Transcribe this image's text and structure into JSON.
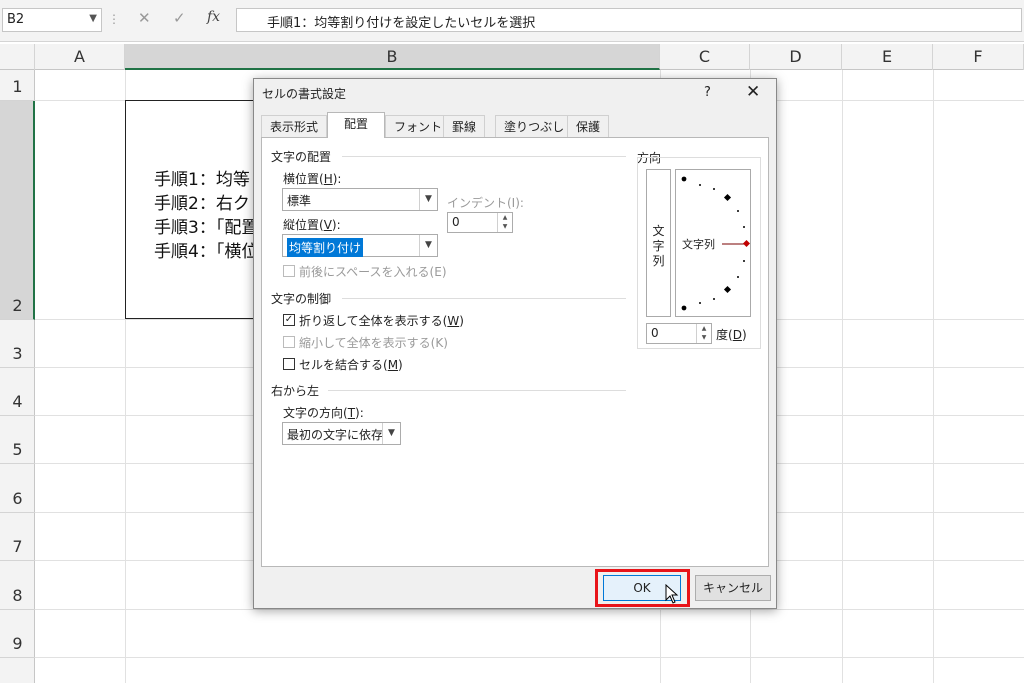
{
  "formula_bar": {
    "name_box": "B2",
    "dots": "⋮",
    "cancel_glyph": "✕",
    "enter_glyph": "✓",
    "fx_label": "fx",
    "formula": "手順1：均等割り付けを設定したいセルを選択"
  },
  "sheet": {
    "columns": [
      "A",
      "B",
      "C",
      "D",
      "E",
      "F"
    ],
    "rows": [
      "1",
      "2",
      "3",
      "4",
      "5",
      "6",
      "7",
      "8",
      "9"
    ],
    "cell_b2_lines": [
      "手順1：均等",
      "手順2：右ク",
      "手順3：「配置",
      "手順4：「横位"
    ],
    "accent": "#217346"
  },
  "dialog": {
    "title": "セルの書式設定",
    "help": "?",
    "close": "✕",
    "tabs": [
      "表示形式",
      "配置",
      "フォント",
      "罫線",
      "塗りつぶし",
      "保護"
    ],
    "active_tab": "配置",
    "text_alignment": {
      "section": "文字の配置",
      "horizontal_label_pre": "横位置(",
      "horizontal_key": "H",
      "horizontal_label_post": "):",
      "horizontal_value": "標準",
      "vertical_label_pre": "縦位置(",
      "vertical_key": "V",
      "vertical_label_post": "):",
      "vertical_value": "均等割り付け",
      "indent_label": "インデント(I):",
      "indent_value": "0",
      "justify_distributed": "前後にスペースを入れる(E)"
    },
    "text_control": {
      "section": "文字の制御",
      "wrap_pre": "折り返して全体を表示する(",
      "wrap_key": "W",
      "wrap_post": ")",
      "wrap_checked": true,
      "shrink": "縮小して全体を表示する(K)",
      "merge_pre": "セルを結合する(",
      "merge_key": "M",
      "merge_post": ")"
    },
    "rtl": {
      "section": "右から左",
      "direction_label_pre": "文字の方向(",
      "direction_key": "T",
      "direction_label_post": "):",
      "direction_value": "最初の文字に依存"
    },
    "orientation": {
      "section": "方向",
      "vertical_chars": [
        "文",
        "字",
        "列"
      ],
      "dial_text": "文字列",
      "degrees_value": "0",
      "degrees_label_pre": "度(",
      "degrees_key": "D",
      "degrees_label_post": ")",
      "marker_color": "#c00000"
    },
    "ok": "OK",
    "cancel": "キャンセル",
    "highlight_color": "#e8141a"
  }
}
